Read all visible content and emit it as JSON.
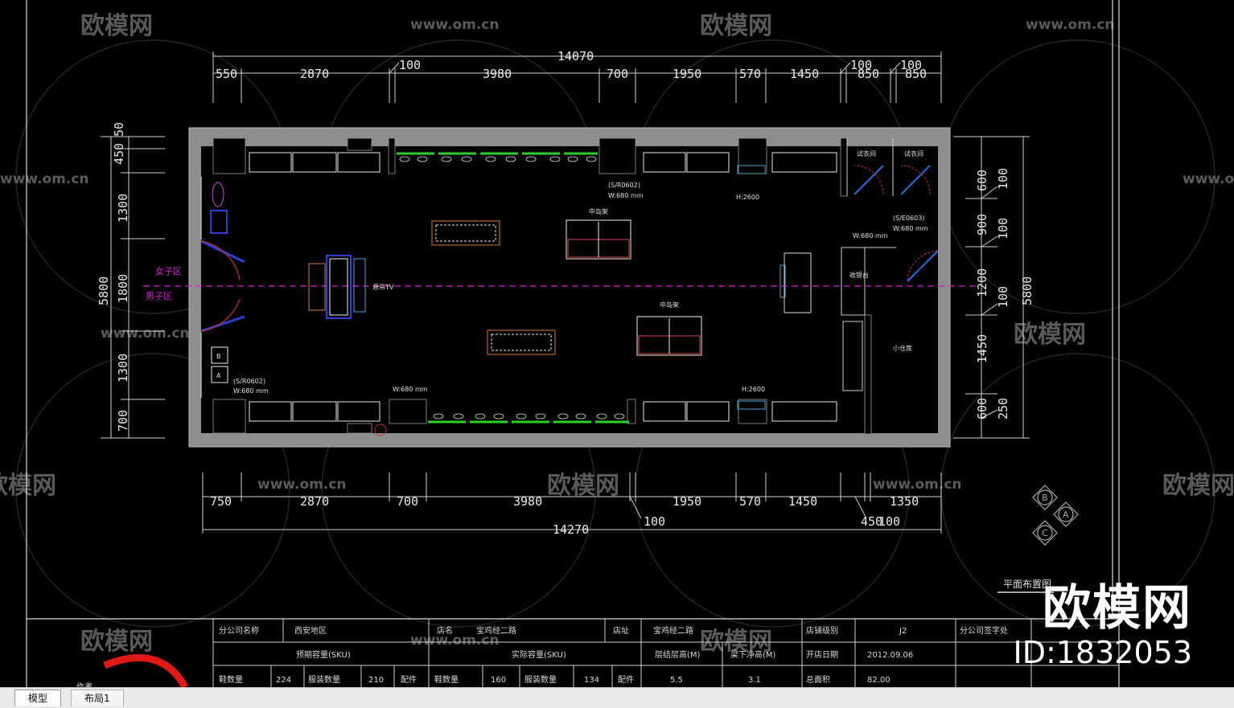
{
  "watermarks": {
    "brand": "欧模网",
    "site": "www.om.cn"
  },
  "brand_overlay": {
    "name": "欧模网",
    "id": "ID:1832053"
  },
  "dims_top": {
    "total": "14070",
    "d1": "550",
    "d2": "2870",
    "d3": "100",
    "d4": "3980",
    "d5": "700",
    "d6": "1950",
    "d7": "570",
    "d8": "1450",
    "d9": "100",
    "d10": "850",
    "d11": "100",
    "d12": "850"
  },
  "dims_bottom": {
    "total": "14270",
    "d1": "750",
    "d2": "2870",
    "d3": "700",
    "d4": "3980",
    "d5": "100",
    "d6": "1950",
    "d7": "570",
    "d8": "1450",
    "d9": "1350",
    "d10": "450",
    "d11": "100"
  },
  "dims_left": {
    "d1": "450",
    "d2": "50",
    "d3": "1300",
    "d4": "5800",
    "d5": "1800",
    "d6": "1300",
    "d7": "700"
  },
  "dims_right": {
    "d1": "600",
    "d2": "100",
    "d3": "900",
    "d4": "100",
    "d5": "1200",
    "d6": "5800",
    "d7": "100",
    "d8": "1450",
    "d9": "600",
    "d10": "250"
  },
  "zones": {
    "female": "女子区",
    "male": "男子区"
  },
  "labels": {
    "tv": "悬吊TV",
    "fitting_a": "试衣间",
    "fitting_b": "试衣间",
    "sku_top": "(S/R0602)",
    "w680_top": "W:680 mm",
    "sku_right": "(S/E0603)",
    "w680_right": "W:680 mm",
    "sku_left": "(S/R0602)",
    "w680_left": "W:680 mm",
    "w680_bottom": "W:680 mm",
    "h2600_top": "H:2600",
    "h2600_bottom": "H:2600",
    "mid_island_1": "中岛架",
    "mid_island_2": "中岛架",
    "cashier": "收银台",
    "storage": "小仓库",
    "b_marker": "B",
    "a_marker": "A"
  },
  "compass": {
    "b": "B",
    "a": "A",
    "c": "C"
  },
  "plan_title": "平面布置图",
  "title_block": {
    "r1c1": "分公司名称",
    "r1c2": "西安地区",
    "r1c3": "店名",
    "r1c4": "宝鸡经二路",
    "r1c5": "店址",
    "r1c6": "宝鸡经二路",
    "r1c7": "店铺级别",
    "r1c8": "J2",
    "r1c9": "分公司签字处",
    "r2c1": "预期容量(SKU)",
    "r2c2": "实际容量(SKU)",
    "r2c3": "层结层高(M)",
    "r2c4": "梁下净高(M)",
    "r2c5": "开店日期",
    "r2c6": "2012.09.06",
    "r3c1": "鞋数量",
    "r3c2": "224",
    "r3c3": "服装数量",
    "r3c4": "210",
    "r3c5": "配件",
    "r3c6": "鞋数量",
    "r3c7": "160",
    "r3c8": "服装数量",
    "r3c9": "134",
    "r3c10": "配件",
    "r3c11": "5.5",
    "r3c12": "3.1",
    "r3c13": "总面积",
    "r3c14": "82.00",
    "left_note": "作者"
  },
  "tabs": [
    {
      "label": "模型"
    },
    {
      "label": "布局1"
    }
  ]
}
